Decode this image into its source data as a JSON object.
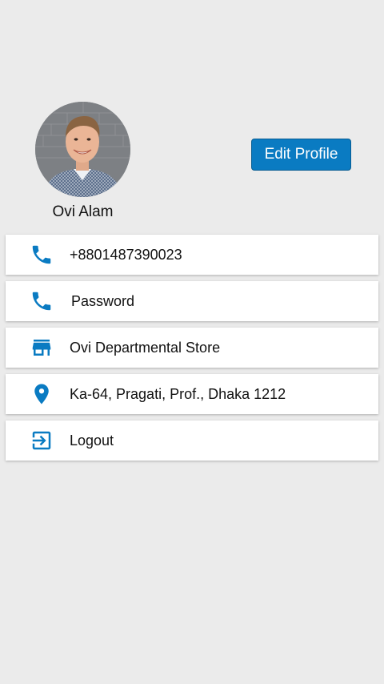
{
  "profile": {
    "name": "Ovi Alam",
    "edit_button": "Edit Profile"
  },
  "items": [
    {
      "icon": "phone-icon",
      "label": "+8801487390023"
    },
    {
      "icon": "phone-icon",
      "label": "Password"
    },
    {
      "icon": "store-icon",
      "label": "Ovi Departmental Store"
    },
    {
      "icon": "location-pin-icon",
      "label": "Ka-64, Pragati, Prof., Dhaka 1212"
    },
    {
      "icon": "logout-icon",
      "label": "Logout"
    }
  ],
  "colors": {
    "accent": "#0a7bc2",
    "background": "#ebebeb",
    "card": "#ffffff"
  }
}
